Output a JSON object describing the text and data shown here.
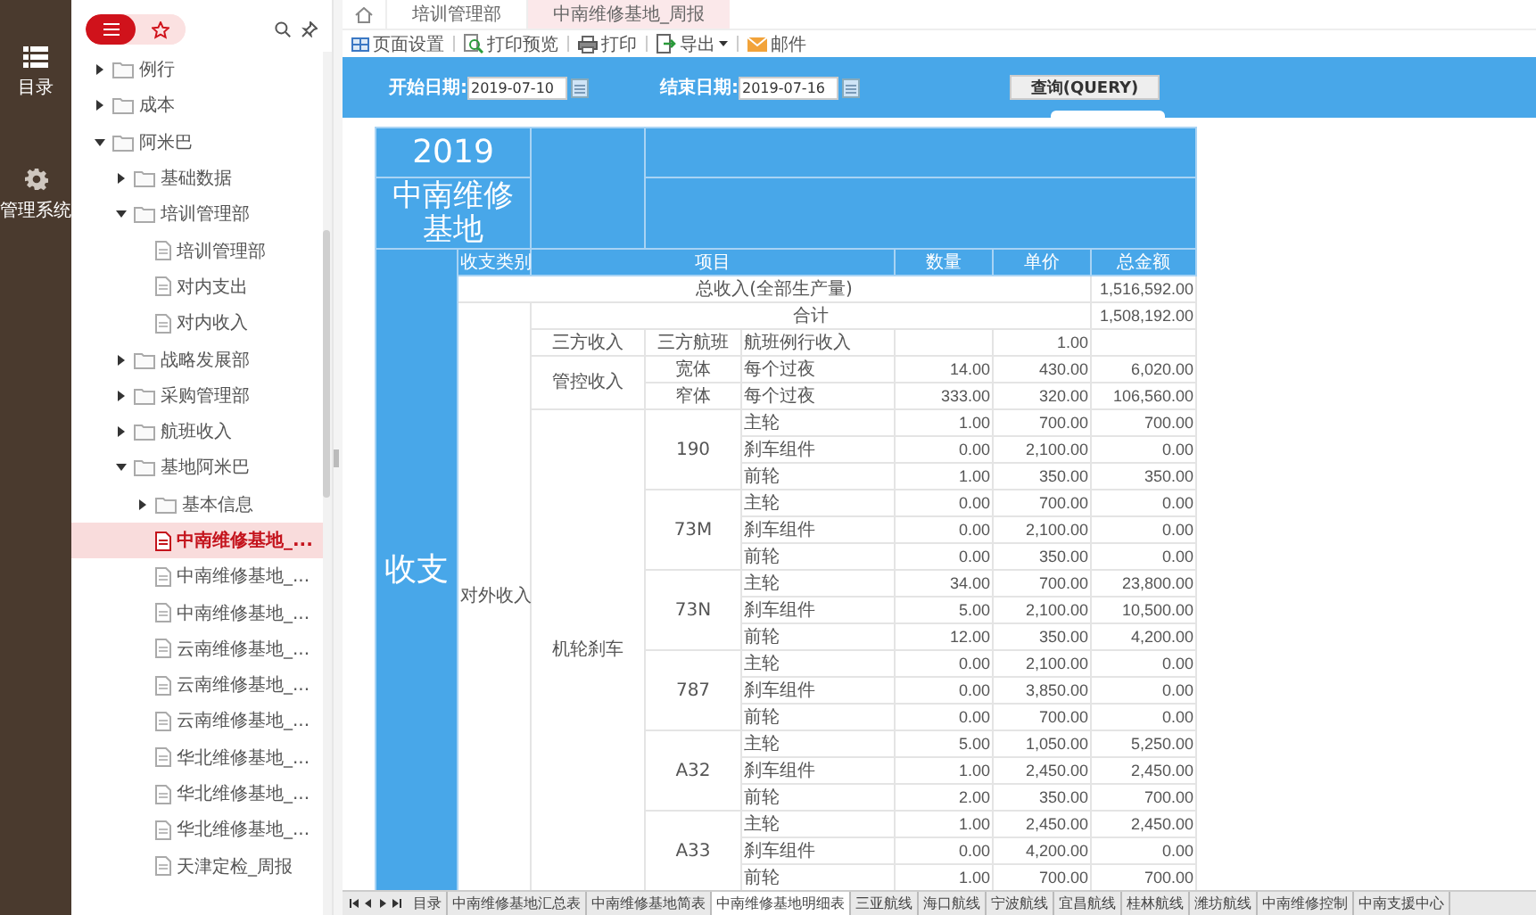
{
  "rail": [
    {
      "label": "目录",
      "kind": "list"
    },
    {
      "label": "管理系统",
      "kind": "gear"
    }
  ],
  "view_toggle": [
    {
      "kind": "list",
      "selected": true
    },
    {
      "kind": "favorites",
      "selected": false
    }
  ],
  "tree": [
    {
      "label": "例行",
      "kind": "folder",
      "expanded": false
    },
    {
      "label": "成本",
      "kind": "folder",
      "expanded": false
    },
    {
      "label": "阿米巴",
      "kind": "folder",
      "expanded": true,
      "children": [
        {
          "label": "基础数据",
          "kind": "folder",
          "expanded": false
        },
        {
          "label": "培训管理部",
          "kind": "folder",
          "expanded": true,
          "children": [
            {
              "label": "培训管理部",
              "kind": "file",
              "selected": false
            },
            {
              "label": "对内支出",
              "kind": "file",
              "selected": false
            },
            {
              "label": "对内收入",
              "kind": "file",
              "selected": false
            }
          ]
        },
        {
          "label": "战略发展部",
          "kind": "folder",
          "expanded": false
        },
        {
          "label": "采购管理部",
          "kind": "folder",
          "expanded": false
        },
        {
          "label": "航班收入",
          "kind": "folder",
          "expanded": false
        },
        {
          "label": "基地阿米巴",
          "kind": "folder",
          "expanded": true,
          "children": [
            {
              "label": "基本信息",
              "kind": "folder",
              "expanded": false
            },
            {
              "label": "中南维修基地_...",
              "kind": "file",
              "selected": true
            },
            {
              "label": "中南维修基地_...",
              "kind": "file",
              "selected": false
            },
            {
              "label": "中南维修基地_...",
              "kind": "file",
              "selected": false
            },
            {
              "label": "云南维修基地_...",
              "kind": "file",
              "selected": false
            },
            {
              "label": "云南维修基地_...",
              "kind": "file",
              "selected": false
            },
            {
              "label": "云南维修基地_...",
              "kind": "file",
              "selected": false
            },
            {
              "label": "华北维修基地_...",
              "kind": "file",
              "selected": false
            },
            {
              "label": "华北维修基地_...",
              "kind": "file",
              "selected": false
            },
            {
              "label": "华北维修基地_...",
              "kind": "file",
              "selected": false
            },
            {
              "label": "天津定检_周报",
              "kind": "file",
              "selected": false
            }
          ]
        }
      ]
    }
  ],
  "page_tabs": [
    {
      "label": "培训管理部",
      "selected": false
    },
    {
      "label": "中南维修基地_周报",
      "selected": true
    }
  ],
  "toolbar": [
    {
      "label": "页面设置",
      "kind": "page-setup"
    },
    {
      "label": "打印预览",
      "kind": "preview"
    },
    {
      "label": "打印",
      "kind": "print"
    },
    {
      "label": "导出",
      "kind": "export",
      "dropdown": true
    },
    {
      "label": "邮件",
      "kind": "mail"
    }
  ],
  "query": {
    "fields": [
      {
        "label": "开始日期:",
        "value": "2019-07-10"
      },
      {
        "label": "结束日期:",
        "value": "2019-07-16"
      }
    ],
    "button": "查询(QUERY)"
  },
  "report": {
    "year": "2019",
    "base": "中南维修基地",
    "side_label": "收支",
    "columns": [
      "收支类别",
      "项目",
      "数量",
      "单价",
      "总金额"
    ],
    "total": {
      "label": "总收入(全部生产量)",
      "amount": "1,516,592.00"
    },
    "subtotal": {
      "category": "对外收入",
      "label": "合计",
      "amount": "1,508,192.00"
    },
    "groups": [
      {
        "label": "三方收入",
        "subgroups": [
          {
            "label": "三方航班",
            "items": [
              {
                "name": "航班例行收入",
                "price": "1.00"
              }
            ]
          }
        ]
      },
      {
        "label": "管控收入",
        "subgroups": [
          {
            "label": "宽体",
            "items": [
              {
                "name": "每个过夜",
                "qty": "14.00",
                "price": "430.00",
                "amount": "6,020.00"
              }
            ]
          },
          {
            "label": "窄体",
            "items": [
              {
                "name": "每个过夜",
                "qty": "333.00",
                "price": "320.00",
                "amount": "106,560.00"
              }
            ]
          }
        ]
      },
      {
        "label": "机轮刹车",
        "subgroups": [
          {
            "label": "190",
            "items": [
              {
                "name": "主轮",
                "qty": "1.00",
                "price": "700.00",
                "amount": "700.00"
              },
              {
                "name": "刹车组件",
                "qty": "0.00",
                "price": "2,100.00",
                "amount": "0.00"
              },
              {
                "name": "前轮",
                "qty": "1.00",
                "price": "350.00",
                "amount": "350.00"
              }
            ]
          },
          {
            "label": "73M",
            "items": [
              {
                "name": "主轮",
                "qty": "0.00",
                "price": "700.00",
                "amount": "0.00"
              },
              {
                "name": "刹车组件",
                "qty": "0.00",
                "price": "2,100.00",
                "amount": "0.00"
              },
              {
                "name": "前轮",
                "qty": "0.00",
                "price": "350.00",
                "amount": "0.00"
              }
            ]
          },
          {
            "label": "73N",
            "items": [
              {
                "name": "主轮",
                "qty": "34.00",
                "price": "700.00",
                "amount": "23,800.00"
              },
              {
                "name": "刹车组件",
                "qty": "5.00",
                "price": "2,100.00",
                "amount": "10,500.00"
              },
              {
                "name": "前轮",
                "qty": "12.00",
                "price": "350.00",
                "amount": "4,200.00"
              }
            ]
          },
          {
            "label": "787",
            "items": [
              {
                "name": "主轮",
                "qty": "0.00",
                "price": "2,100.00",
                "amount": "0.00"
              },
              {
                "name": "刹车组件",
                "qty": "0.00",
                "price": "3,850.00",
                "amount": "0.00"
              },
              {
                "name": "前轮",
                "qty": "0.00",
                "price": "700.00",
                "amount": "0.00"
              }
            ]
          },
          {
            "label": "A32",
            "items": [
              {
                "name": "主轮",
                "qty": "5.00",
                "price": "1,050.00",
                "amount": "5,250.00"
              },
              {
                "name": "刹车组件",
                "qty": "1.00",
                "price": "2,450.00",
                "amount": "2,450.00"
              },
              {
                "name": "前轮",
                "qty": "2.00",
                "price": "350.00",
                "amount": "700.00"
              }
            ]
          },
          {
            "label": "A33",
            "items": [
              {
                "name": "主轮",
                "qty": "1.00",
                "price": "2,450.00",
                "amount": "2,450.00"
              },
              {
                "name": "刹车组件",
                "qty": "0.00",
                "price": "4,200.00",
                "amount": "0.00"
              },
              {
                "name": "前轮",
                "qty": "1.00",
                "price": "700.00",
                "amount": "700.00"
              }
            ]
          }
        ]
      }
    ]
  },
  "sheet_tabs": [
    {
      "label": "目录",
      "selected": false
    },
    {
      "label": "中南维修基地汇总表",
      "selected": false
    },
    {
      "label": "中南维修基地简表",
      "selected": false
    },
    {
      "label": "中南维修基地明细表",
      "selected": true
    },
    {
      "label": "三亚航线",
      "selected": false
    },
    {
      "label": "海口航线",
      "selected": false
    },
    {
      "label": "宁波航线",
      "selected": false
    },
    {
      "label": "宜昌航线",
      "selected": false
    },
    {
      "label": "桂林航线",
      "selected": false
    },
    {
      "label": "潍坊航线",
      "selected": false
    },
    {
      "label": "中南维修控制",
      "selected": false
    },
    {
      "label": "中南支援中心",
      "selected": false
    }
  ]
}
